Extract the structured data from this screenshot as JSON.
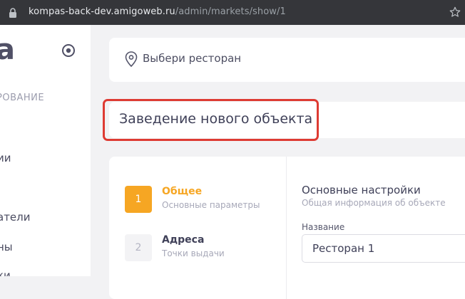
{
  "browser": {
    "url_host": "kompas-back-dev.amigoweb.ru",
    "url_path": "/admin/markets/show/1"
  },
  "sidebar": {
    "brand": "a",
    "section_label": "РОВАНИЕ",
    "items": [
      {
        "label": "ии"
      },
      {
        "label": "атели"
      },
      {
        "label": "ны"
      },
      {
        "label": "ки"
      }
    ]
  },
  "restaurant_select": {
    "label": "Выбери ресторан"
  },
  "page": {
    "title": "Заведение нового объекта"
  },
  "steps": [
    {
      "number": "1",
      "title": "Общее",
      "subtitle": "Основные параметры",
      "active": true
    },
    {
      "number": "2",
      "title": "Адреса",
      "subtitle": "Точки выдачи",
      "active": false
    }
  ],
  "settings_section": {
    "title": "Основные настройки",
    "subtitle": "Общая информация об объекте",
    "name_label": "Название",
    "name_value": "Ресторан 1"
  },
  "colors": {
    "accent": "#f6a623",
    "highlight_border": "#de3b33",
    "text_primary": "#3f4058"
  }
}
